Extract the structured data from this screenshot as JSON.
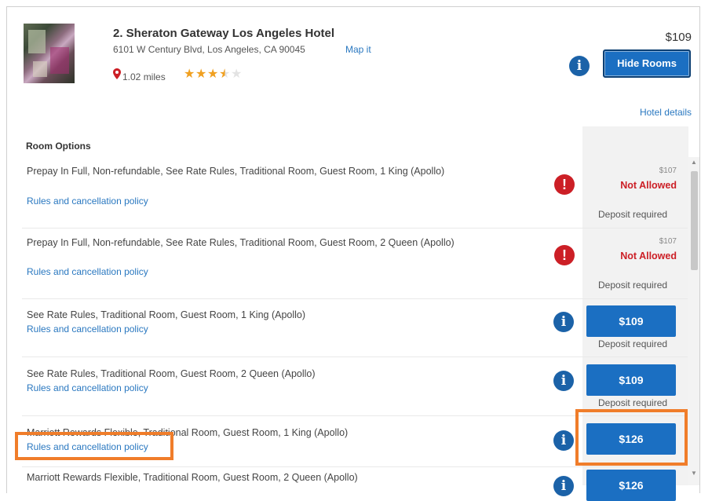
{
  "hotel": {
    "name": "2. Sheraton Gateway Los Angeles Hotel",
    "address": "6101 W Century Blvd, Los Angeles, CA 90045",
    "map_link": "Map it",
    "distance": "1.02 miles",
    "rating": 3.5,
    "stars": [
      "★",
      "★",
      "★",
      "★",
      "★"
    ],
    "price": "$109",
    "hide_rooms_label": "Hide Rooms",
    "hotel_details_label": "Hotel details"
  },
  "section_title": "Room Options",
  "icons": {
    "info": "i",
    "alert": "!"
  },
  "rooms": [
    {
      "description": "Prepay In Full, Non-refundable, See Rate Rules, Traditional Room, Guest Room, 1 King (Apollo)",
      "rules_link": "Rules and cancellation policy",
      "small_price": "$107",
      "status": "Not Allowed",
      "deposit": "Deposit required"
    },
    {
      "description": "Prepay In Full, Non-refundable, See Rate Rules, Traditional Room, Guest Room, 2 Queen (Apollo)",
      "rules_link": "Rules and cancellation policy",
      "small_price": "$107",
      "status": "Not Allowed",
      "deposit": "Deposit required"
    },
    {
      "description": "See Rate Rules, Traditional Room, Guest Room, 1 King (Apollo)",
      "rules_link": "Rules and cancellation policy",
      "price": "$109",
      "deposit": "Deposit required"
    },
    {
      "description": "See Rate Rules, Traditional Room, Guest Room, 2 Queen (Apollo)",
      "rules_link": "Rules and cancellation policy",
      "price": "$109",
      "deposit": "Deposit required"
    },
    {
      "description": "Marriott Rewards Flexible, Traditional Room, Guest Room, 1 King (Apollo)",
      "rules_link": "Rules and cancellation policy",
      "price": "$126"
    },
    {
      "description": "Marriott Rewards Flexible, Traditional Room, Guest Room, 2 Queen (Apollo)",
      "price": "$126"
    }
  ],
  "colors": {
    "accent_blue": "#1b6fc2",
    "link_blue": "#2a78c0",
    "alert_red": "#cc1f26",
    "highlight_orange": "#f07d2a"
  }
}
